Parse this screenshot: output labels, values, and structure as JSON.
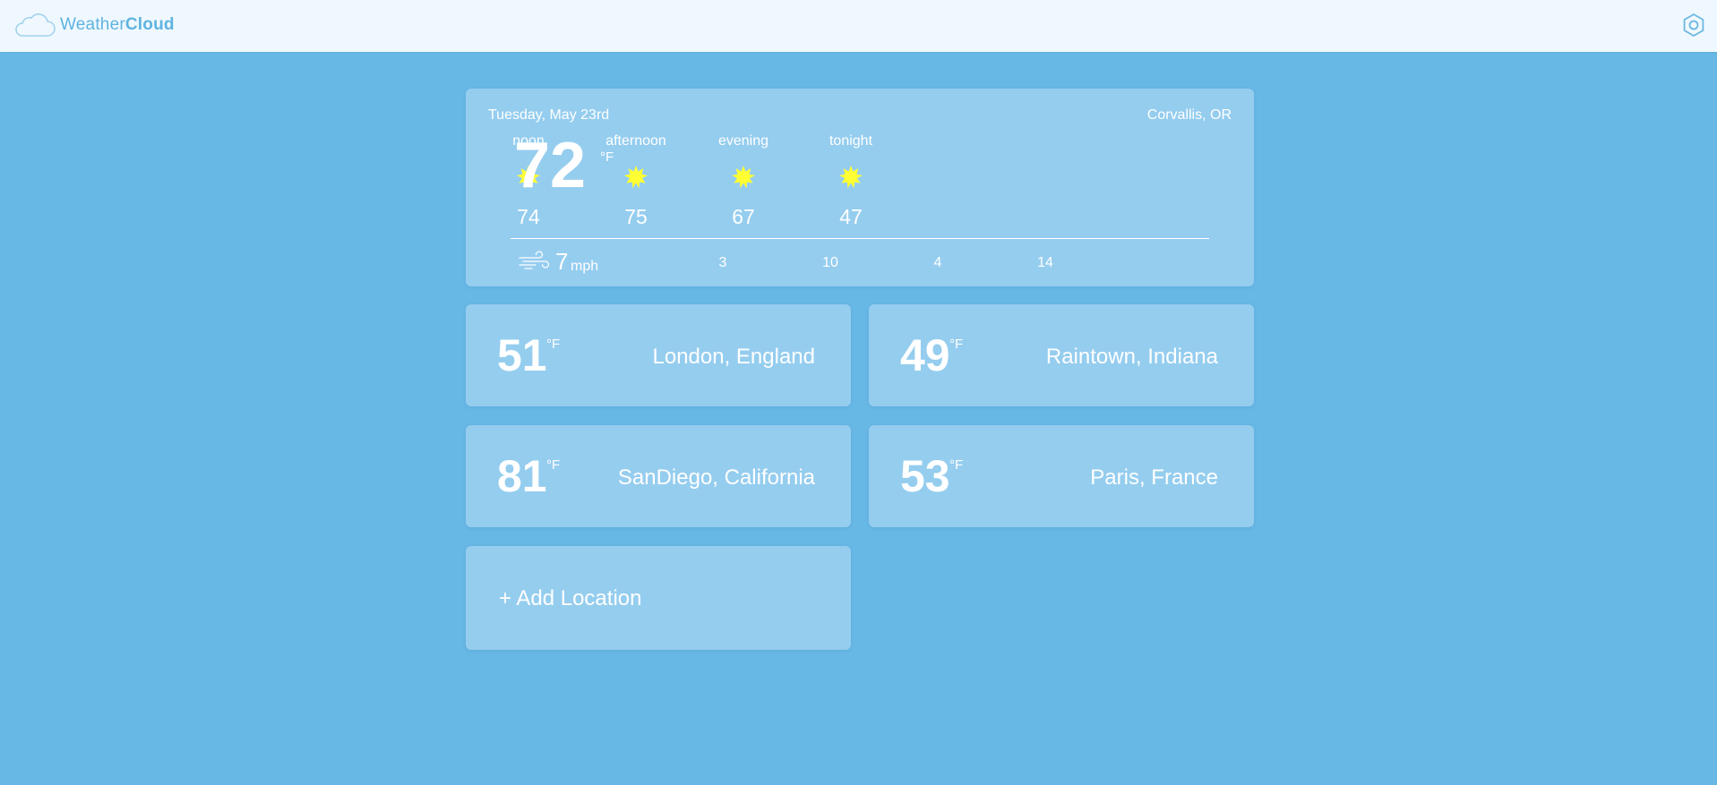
{
  "app": {
    "name_light": "Weather",
    "name_bold": "Cloud",
    "logo_icon": "cloud-icon",
    "settings_icon": "gear-icon"
  },
  "colors": {
    "background": "#68b8e6",
    "card": "#95cdef",
    "topbar": "#eff8fe",
    "brand": "#5fb3e0",
    "sun": "#ffff00"
  },
  "current": {
    "date": "Tuesday, May 23rd",
    "location": "Corvallis, OR",
    "temp": "72",
    "unit": "°F",
    "periods": [
      {
        "label": "noon",
        "temp": "74",
        "icon": "sun-icon"
      },
      {
        "label": "afternoon",
        "temp": "75",
        "icon": "sun-icon"
      },
      {
        "label": "evening",
        "temp": "67",
        "icon": "sun-icon"
      },
      {
        "label": "tonight",
        "temp": "47",
        "icon": "sun-icon"
      }
    ],
    "wind": {
      "icon": "wind-icon",
      "value": "7",
      "unit": "mph",
      "values": [
        "3",
        "10",
        "4",
        "14"
      ]
    }
  },
  "locations": [
    {
      "temp": "51",
      "unit": "°F",
      "name": "London, England"
    },
    {
      "temp": "49",
      "unit": "°F",
      "name": "Raintown, Indiana"
    },
    {
      "temp": "81",
      "unit": "°F",
      "name": "SanDiego, California"
    },
    {
      "temp": "53",
      "unit": "°F",
      "name": "Paris, France"
    }
  ],
  "add_location": {
    "label": "+ Add Location"
  }
}
